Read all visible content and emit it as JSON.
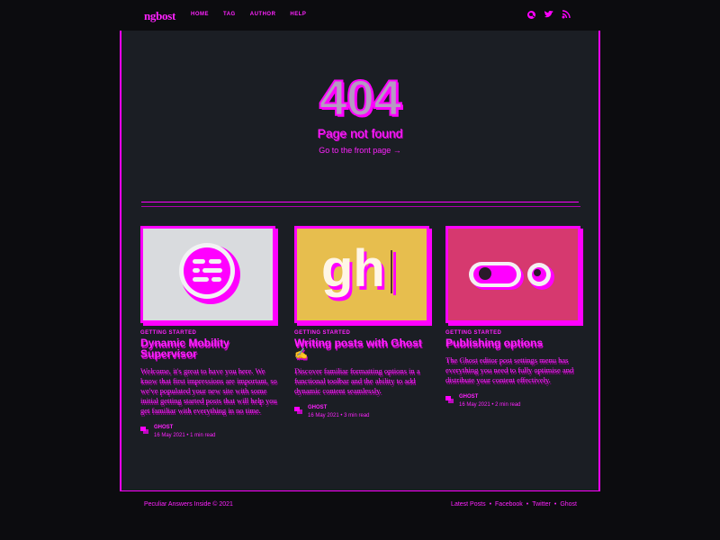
{
  "header": {
    "logo": "ngbost",
    "nav": [
      "Home",
      "Tag",
      "Author",
      "Help"
    ],
    "social_icons": [
      "search-icon",
      "twitter-icon",
      "rss-icon"
    ]
  },
  "error": {
    "code": "404",
    "message": "Page not found",
    "link": "Go to the front page →"
  },
  "cards": [
    {
      "tag": "Getting started",
      "title": "Dynamic Mobility Supervisor",
      "excerpt": "Welcome, it's great to have you here. We know that first impressions are important, so we've populated your new site with some initial getting started posts that will help you get familiar with everything in no time.",
      "author": "Ghost",
      "date": "16 May 2021",
      "read": "1 min read",
      "image": "ghost-logo-icon"
    },
    {
      "tag": "Getting started",
      "title": "Writing posts with Ghost ✍️",
      "excerpt": "Discover familiar formatting options in a functional toolbar and the ability to add dynamic content seamlessly.",
      "author": "Ghost",
      "date": "16 May 2021",
      "read": "3 min read",
      "image": "gh-editor-icon"
    },
    {
      "tag": "Getting started",
      "title": "Publishing options",
      "excerpt": "The Ghost editor post settings menu has everything you need to fully optimise and distribute your content effectively.",
      "author": "Ghost",
      "date": "16 May 2021",
      "read": "2 min read",
      "image": "toggle-switch-icon"
    }
  ],
  "footer": {
    "copyright": "Peculiar Answers Inside © 2021",
    "links": [
      "Latest Posts",
      "Facebook",
      "Twitter",
      "Ghost"
    ]
  },
  "colors": {
    "accent": "#ff00ff",
    "panel_bg": "#1b1e24",
    "page_bg": "#0c0c0f",
    "card1_bg": "#d9dbde",
    "card2_bg": "#e7be4e",
    "card3_bg": "#d6396f"
  }
}
